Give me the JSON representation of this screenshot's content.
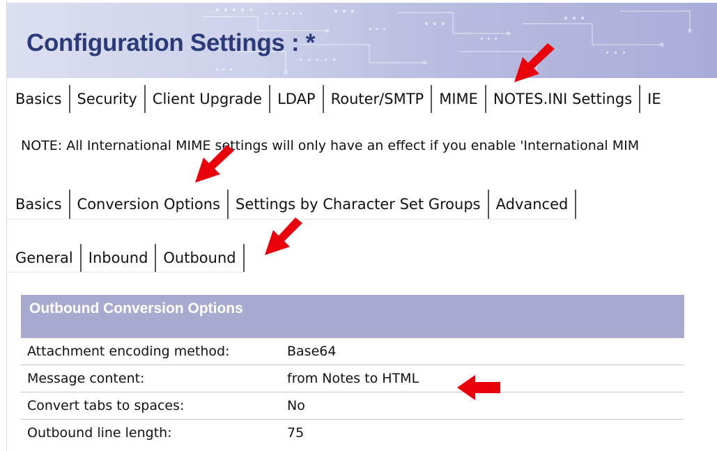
{
  "app": {
    "title": "Configuration Settings : *"
  },
  "main_tabs": [
    {
      "label": "Basics",
      "active": false
    },
    {
      "label": "Security",
      "active": false
    },
    {
      "label": "Client Upgrade",
      "active": false
    },
    {
      "label": "LDAP",
      "active": false
    },
    {
      "label": "Router/SMTP",
      "active": false
    },
    {
      "label": "MIME",
      "active": true
    },
    {
      "label": "NOTES.INI Settings",
      "active": false
    },
    {
      "label": "IE",
      "active": false
    }
  ],
  "note": {
    "text": "NOTE: All International MIME settings will only have an effect if you enable 'International MIM"
  },
  "sub_tabs": [
    {
      "label": "Basics",
      "active": false
    },
    {
      "label": "Conversion Options",
      "active": true
    },
    {
      "label": "Settings by Character Set Groups",
      "active": false
    },
    {
      "label": "Advanced",
      "active": false
    }
  ],
  "sub2_tabs": [
    {
      "label": "General",
      "active": false
    },
    {
      "label": "Inbound",
      "active": false
    },
    {
      "label": "Outbound",
      "active": true
    }
  ],
  "section": {
    "title": "Outbound Conversion Options",
    "rows": [
      {
        "label": "Attachment encoding method:",
        "value": "Base64"
      },
      {
        "label": "Message content:",
        "value": "from Notes to HTML"
      },
      {
        "label": "Convert tabs to spaces:",
        "value": "No"
      },
      {
        "label": "Outbound line length:",
        "value": "75"
      }
    ]
  },
  "colors": {
    "title": "#2b3a78",
    "section_header": "#a8aacf",
    "annotation_arrow": "#e8000b"
  },
  "annotations": [
    "red-arrow",
    "red-arrow",
    "red-arrow",
    "red-arrow"
  ]
}
